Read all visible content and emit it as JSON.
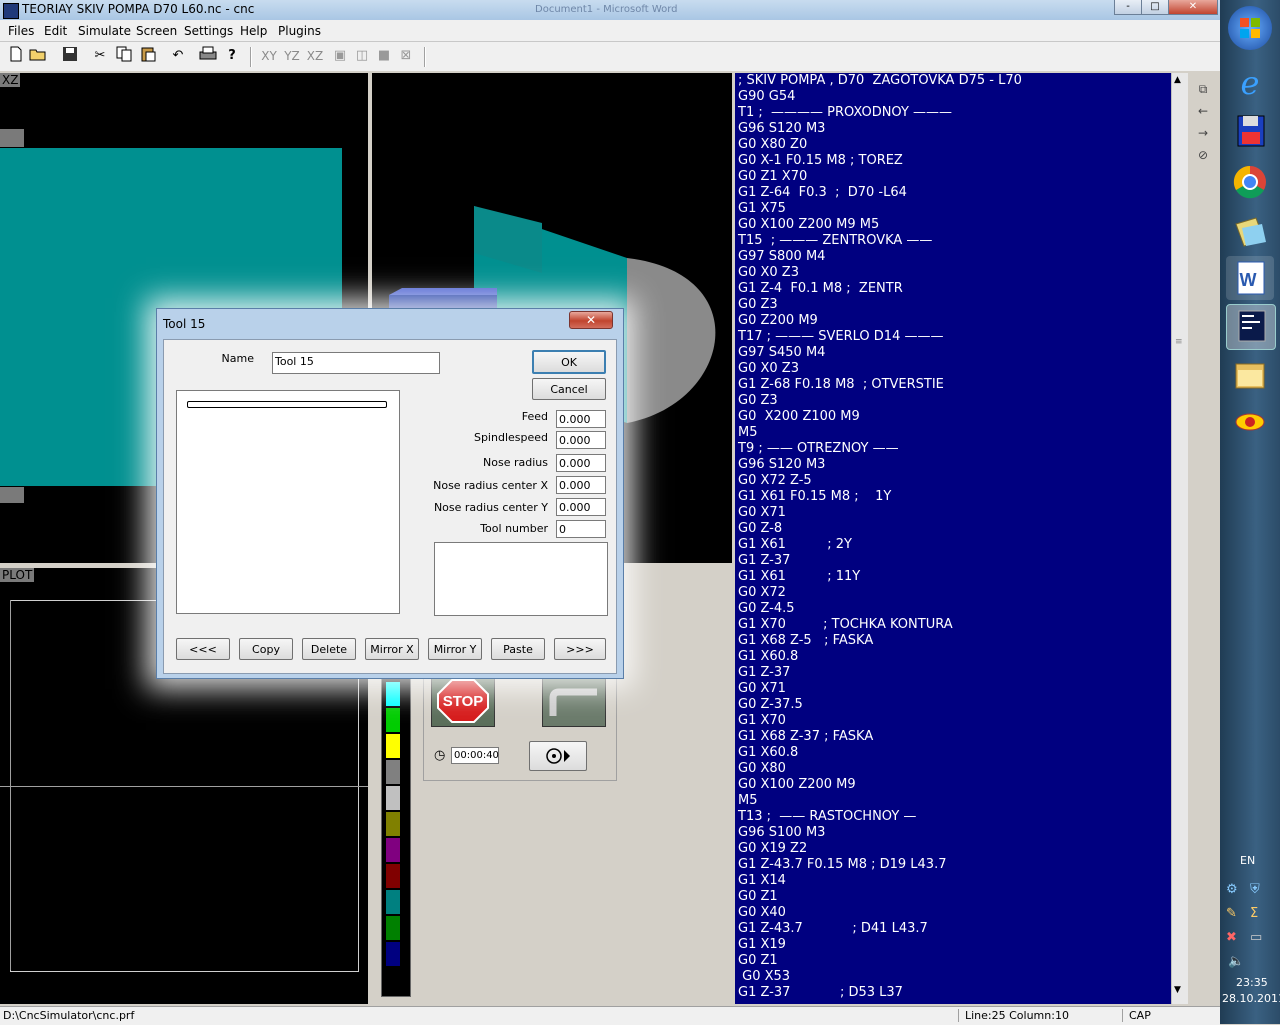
{
  "window": {
    "title": "TEORIAY SKIV POMPA D70 L60.nc - cnc",
    "ghost_title": "Document1 - Microsoft Word",
    "controls": {
      "minimize": "-",
      "maximize": "□",
      "close": "✕"
    }
  },
  "menu": [
    "Files",
    "Edit",
    "Simulate",
    "Screen",
    "Settings",
    "Help",
    "Plugins"
  ],
  "toolbar": {
    "buttons": [
      "new-icon",
      "open-icon",
      "save-icon",
      "cut-icon",
      "copy-icon",
      "paste-icon",
      "undo-icon",
      "print-icon",
      "help-icon"
    ],
    "planes": [
      "XY",
      "YZ",
      "XZ"
    ]
  },
  "views": {
    "xz_label": "XZ",
    "plot_label": "PLOT"
  },
  "controls": {
    "timer": "00:00:40",
    "stop": "STOP"
  },
  "palette_colors": [
    "#00ffff",
    "#00cc00",
    "#ffff00",
    "#808080",
    "#c0c0c0",
    "#808000",
    "#800080",
    "#800000",
    "#008080",
    "#008000",
    "#000080"
  ],
  "gcode": [
    "; SKIV POMPA , D70  ZAGOTOVKA D75 - L70",
    "G90 G54",
    "T1 ;  ———— PROXODNOY ———",
    "G96 S120 M3",
    "G0 X80 Z0",
    "G0 X-1 F0.15 M8 ; TOREZ",
    "G0 Z1 X70",
    "G1 Z-64  F0.3  ;  D70 -L64",
    "G1 X75",
    "G0 X100 Z200 M9 M5",
    "T15  ; ——— ZENTROVKA ——",
    "G97 S800 M4",
    "G0 X0 Z3",
    "G1 Z-4  F0.1 M8 ;  ZENTR",
    "G0 Z3",
    "G0 Z200 M9",
    "T17 ; ——— SVERLO D14 ———",
    "G97 S450 M4",
    "G0 X0 Z3",
    "G1 Z-68 F0.18 M8  ; OTVERSTIE",
    "G0 Z3",
    "G0  X200 Z100 M9",
    "M5",
    "T9 ; —— OTREZNOY ——",
    "G96 S120 M3",
    "G0 X72 Z-5",
    "G1 X61 F0.15 M8 ;    1Y",
    "G0 X71",
    "G0 Z-8",
    "G1 X61          ; 2Y",
    "G1 Z-37",
    "G1 X61          ; 11Y",
    "G0 X72",
    "G0 Z-4.5",
    "G1 X70         ; TOCHKA KONTURA",
    "G1 X68 Z-5   ; FASKA",
    "G1 X60.8",
    "G1 Z-37",
    "G0 X71",
    "G0 Z-37.5",
    "G1 X70",
    "G1 X68 Z-37 ; FASKA",
    "G1 X60.8",
    "G0 X80",
    "G0 X100 Z200 M9",
    "M5",
    "T13 ;  —— RASTOCHNOY —",
    "G96 S100 M3",
    "G0 X19 Z2",
    "G1 Z-43.7 F0.15 M8 ; D19 L43.7",
    "G1 X14",
    "G0 Z1",
    "G0 X40",
    "G1 Z-43.7            ; D41 L43.7",
    "G1 X19",
    "G0 Z1",
    " G0 X53",
    "G1 Z-37            ; D53 L37"
  ],
  "status": {
    "path": "D:\\CncSimulator\\cnc.prf",
    "position": "Line:25 Column:10",
    "caps": "CAP"
  },
  "taskbar": {
    "items": [
      "windows-start-icon",
      "internet-explorer-icon",
      "floppy-save-icon",
      "chrome-icon",
      "folder-icon",
      "word-icon",
      "cnc-app-icon",
      "explorer-icon",
      "eye-app-icon"
    ],
    "lang": "EN",
    "time": "23:35",
    "date": "28.10.2011"
  },
  "dialog": {
    "title": "Tool 15",
    "close": "✕",
    "name_label": "Name",
    "name_value": "Tool 15",
    "ok": "OK",
    "cancel": "Cancel",
    "fields": [
      {
        "label": "Feed",
        "value": "0.000"
      },
      {
        "label": "Spindlespeed",
        "value": "0.000"
      },
      {
        "label": "Nose radius",
        "value": "0.000"
      },
      {
        "label": "Nose radius center X",
        "value": "0.000"
      },
      {
        "label": "Nose radius center Y",
        "value": "0.000"
      },
      {
        "label": "Tool number",
        "value": "0"
      }
    ],
    "buttons": [
      "<<<",
      "Copy",
      "Delete",
      "Mirror X",
      "Mirror Y",
      "Paste",
      ">>>"
    ]
  }
}
